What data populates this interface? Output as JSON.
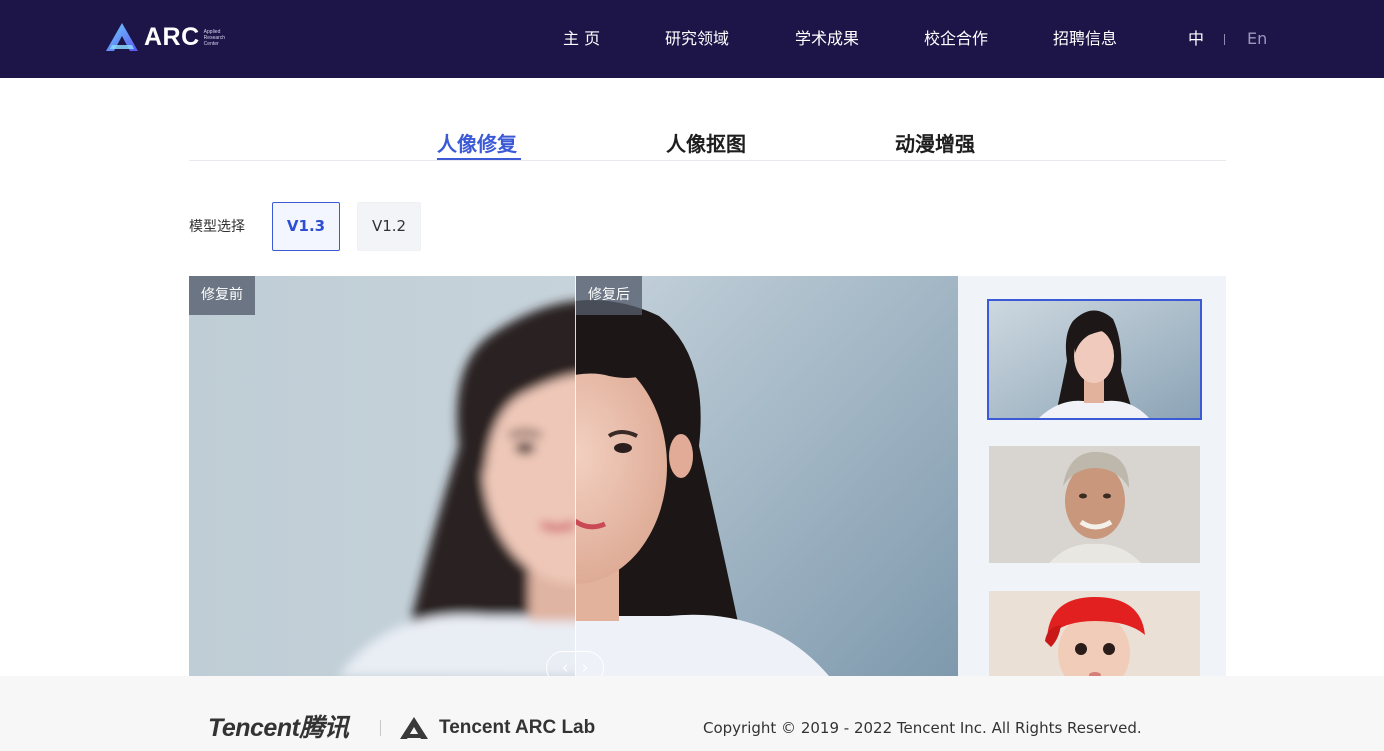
{
  "header": {
    "logo": {
      "text": "ARC",
      "sub": [
        "Applied",
        "Research",
        "Center"
      ]
    },
    "nav": [
      {
        "label": "主 页"
      },
      {
        "label": "研究领域"
      },
      {
        "label": "学术成果"
      },
      {
        "label": "校企合作"
      },
      {
        "label": "招聘信息"
      }
    ],
    "lang": {
      "zh": "中",
      "en": "En",
      "active": "zh"
    }
  },
  "tabs": [
    {
      "label": "人像修复",
      "active": true
    },
    {
      "label": "人像抠图",
      "active": false
    },
    {
      "label": "动漫增强",
      "active": false
    }
  ],
  "model": {
    "label": "模型选择",
    "options": [
      {
        "label": "V1.3",
        "selected": true
      },
      {
        "label": "V1.2",
        "selected": false
      }
    ]
  },
  "viewer": {
    "before_label": "修复前",
    "after_label": "修复后",
    "handle_left": "‹",
    "handle_right": "›"
  },
  "thumbnails": [
    {
      "name": "young-woman-portrait",
      "selected": true
    },
    {
      "name": "older-man-portrait",
      "selected": false
    },
    {
      "name": "baby-red-hat-portrait",
      "selected": false
    }
  ],
  "footer": {
    "tencent": "Tencent腾讯",
    "lab": "Tencent ARC Lab",
    "copyright": "Copyright © 2019 - 2022 Tencent Inc. All Rights Reserved."
  },
  "colors": {
    "header_bg": "#1d1447",
    "accent": "#3d5ad6",
    "footer_bg": "#f7f7f8"
  }
}
